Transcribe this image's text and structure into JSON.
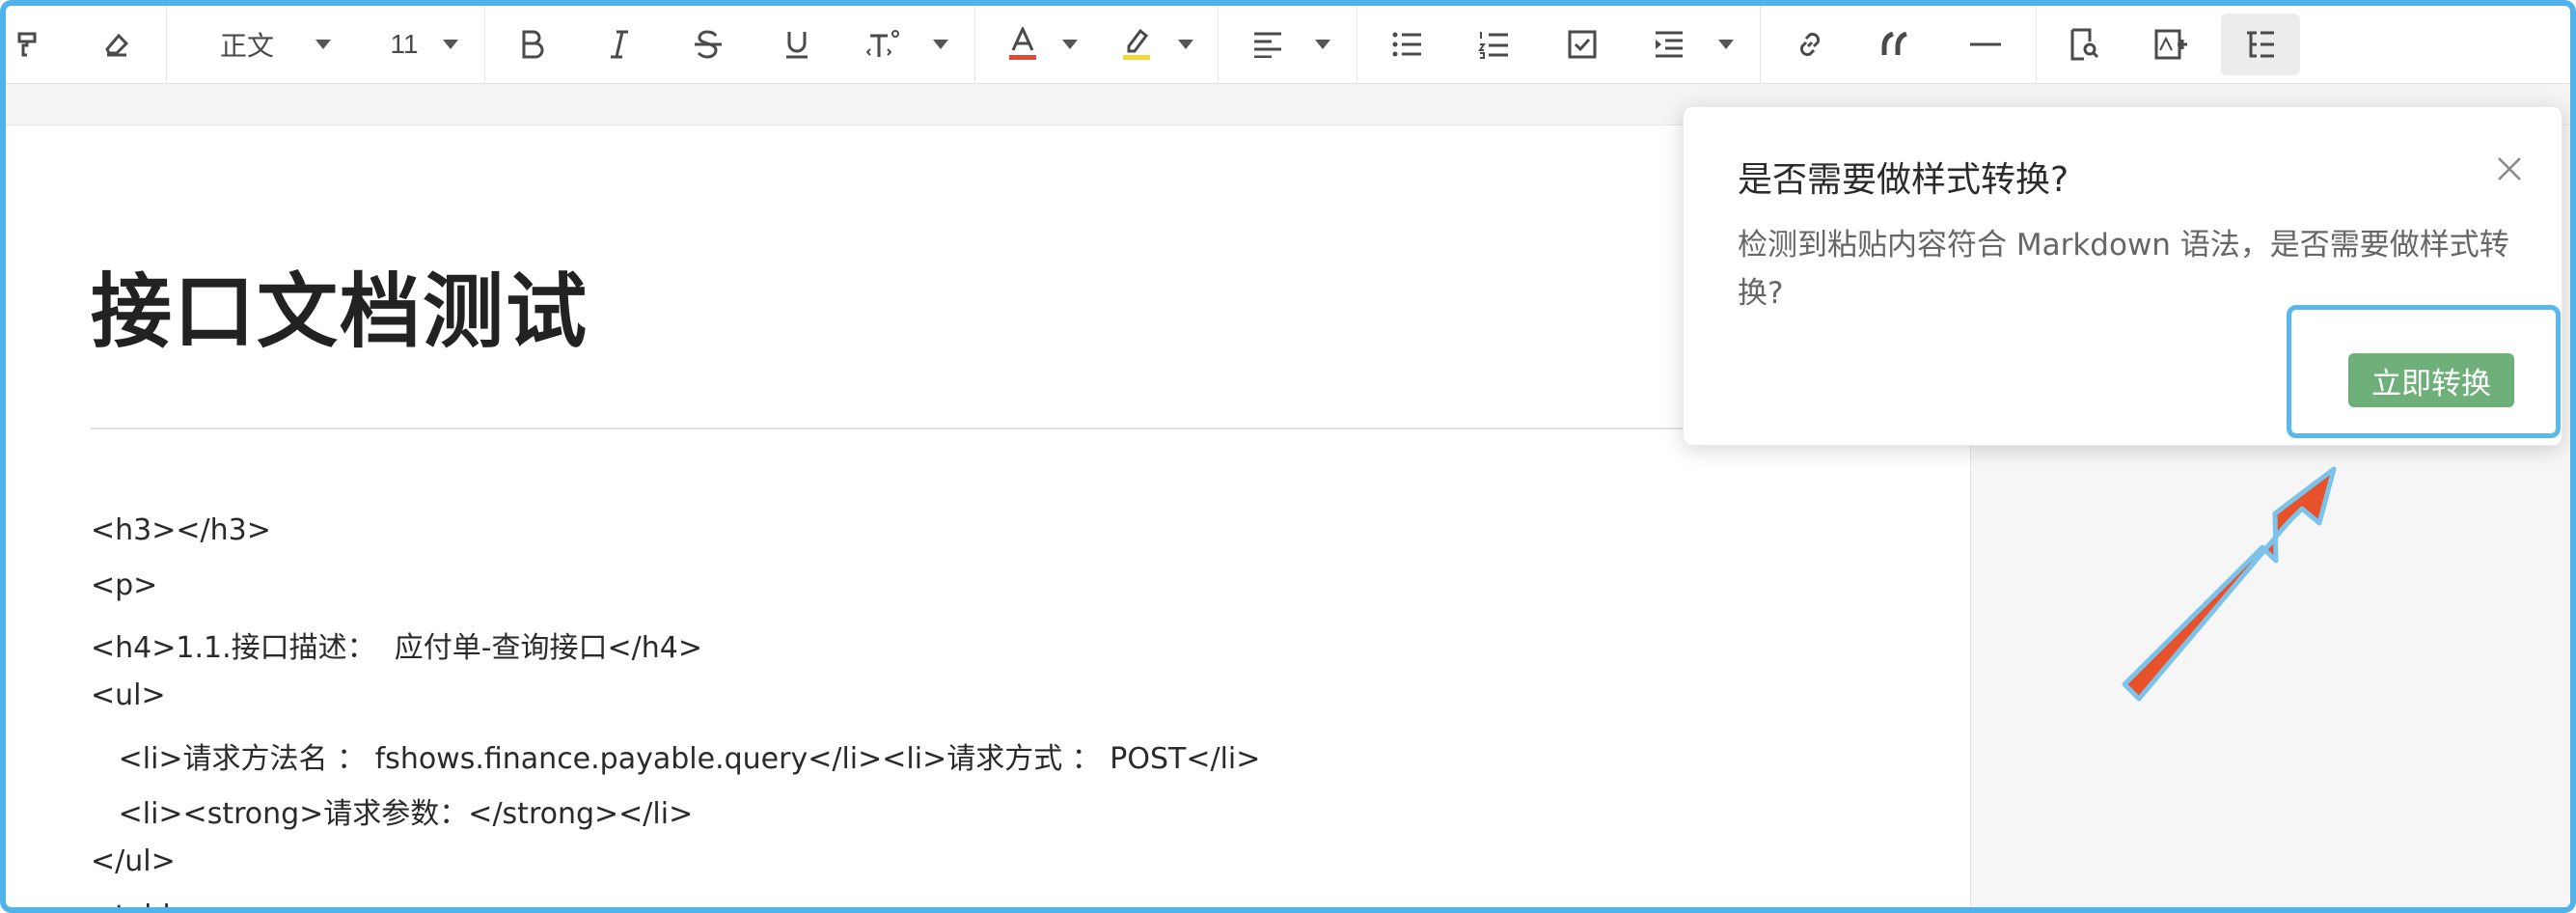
{
  "toolbar": {
    "paragraph_style": "正文",
    "font_size": "11"
  },
  "document": {
    "title": "接口文档测试",
    "lines": [
      "<h3></h3>",
      "<p>",
      "<h4>1.1.接口描述：  应付单-查询接口</h4>",
      "<ul>",
      "   <li>请求方法名 ： fshows.finance.payable.query</li><li>请求方式 ： POST</li>",
      "   <li><strong>请求参数：</strong></li>",
      "</ul>",
      "<table>"
    ]
  },
  "dialog": {
    "title": "是否需要做样式转换?",
    "message": "检测到粘贴内容符合 Markdown 语法，是否需要做样式转换?",
    "confirm_label": "立即转换"
  },
  "colors": {
    "frame_border": "#4fb3ea",
    "confirm_button": "#6fb07a",
    "font_color_underline": "#e04a3a",
    "highlight_underline": "#f4d83a",
    "arrow": "#e8522a"
  }
}
